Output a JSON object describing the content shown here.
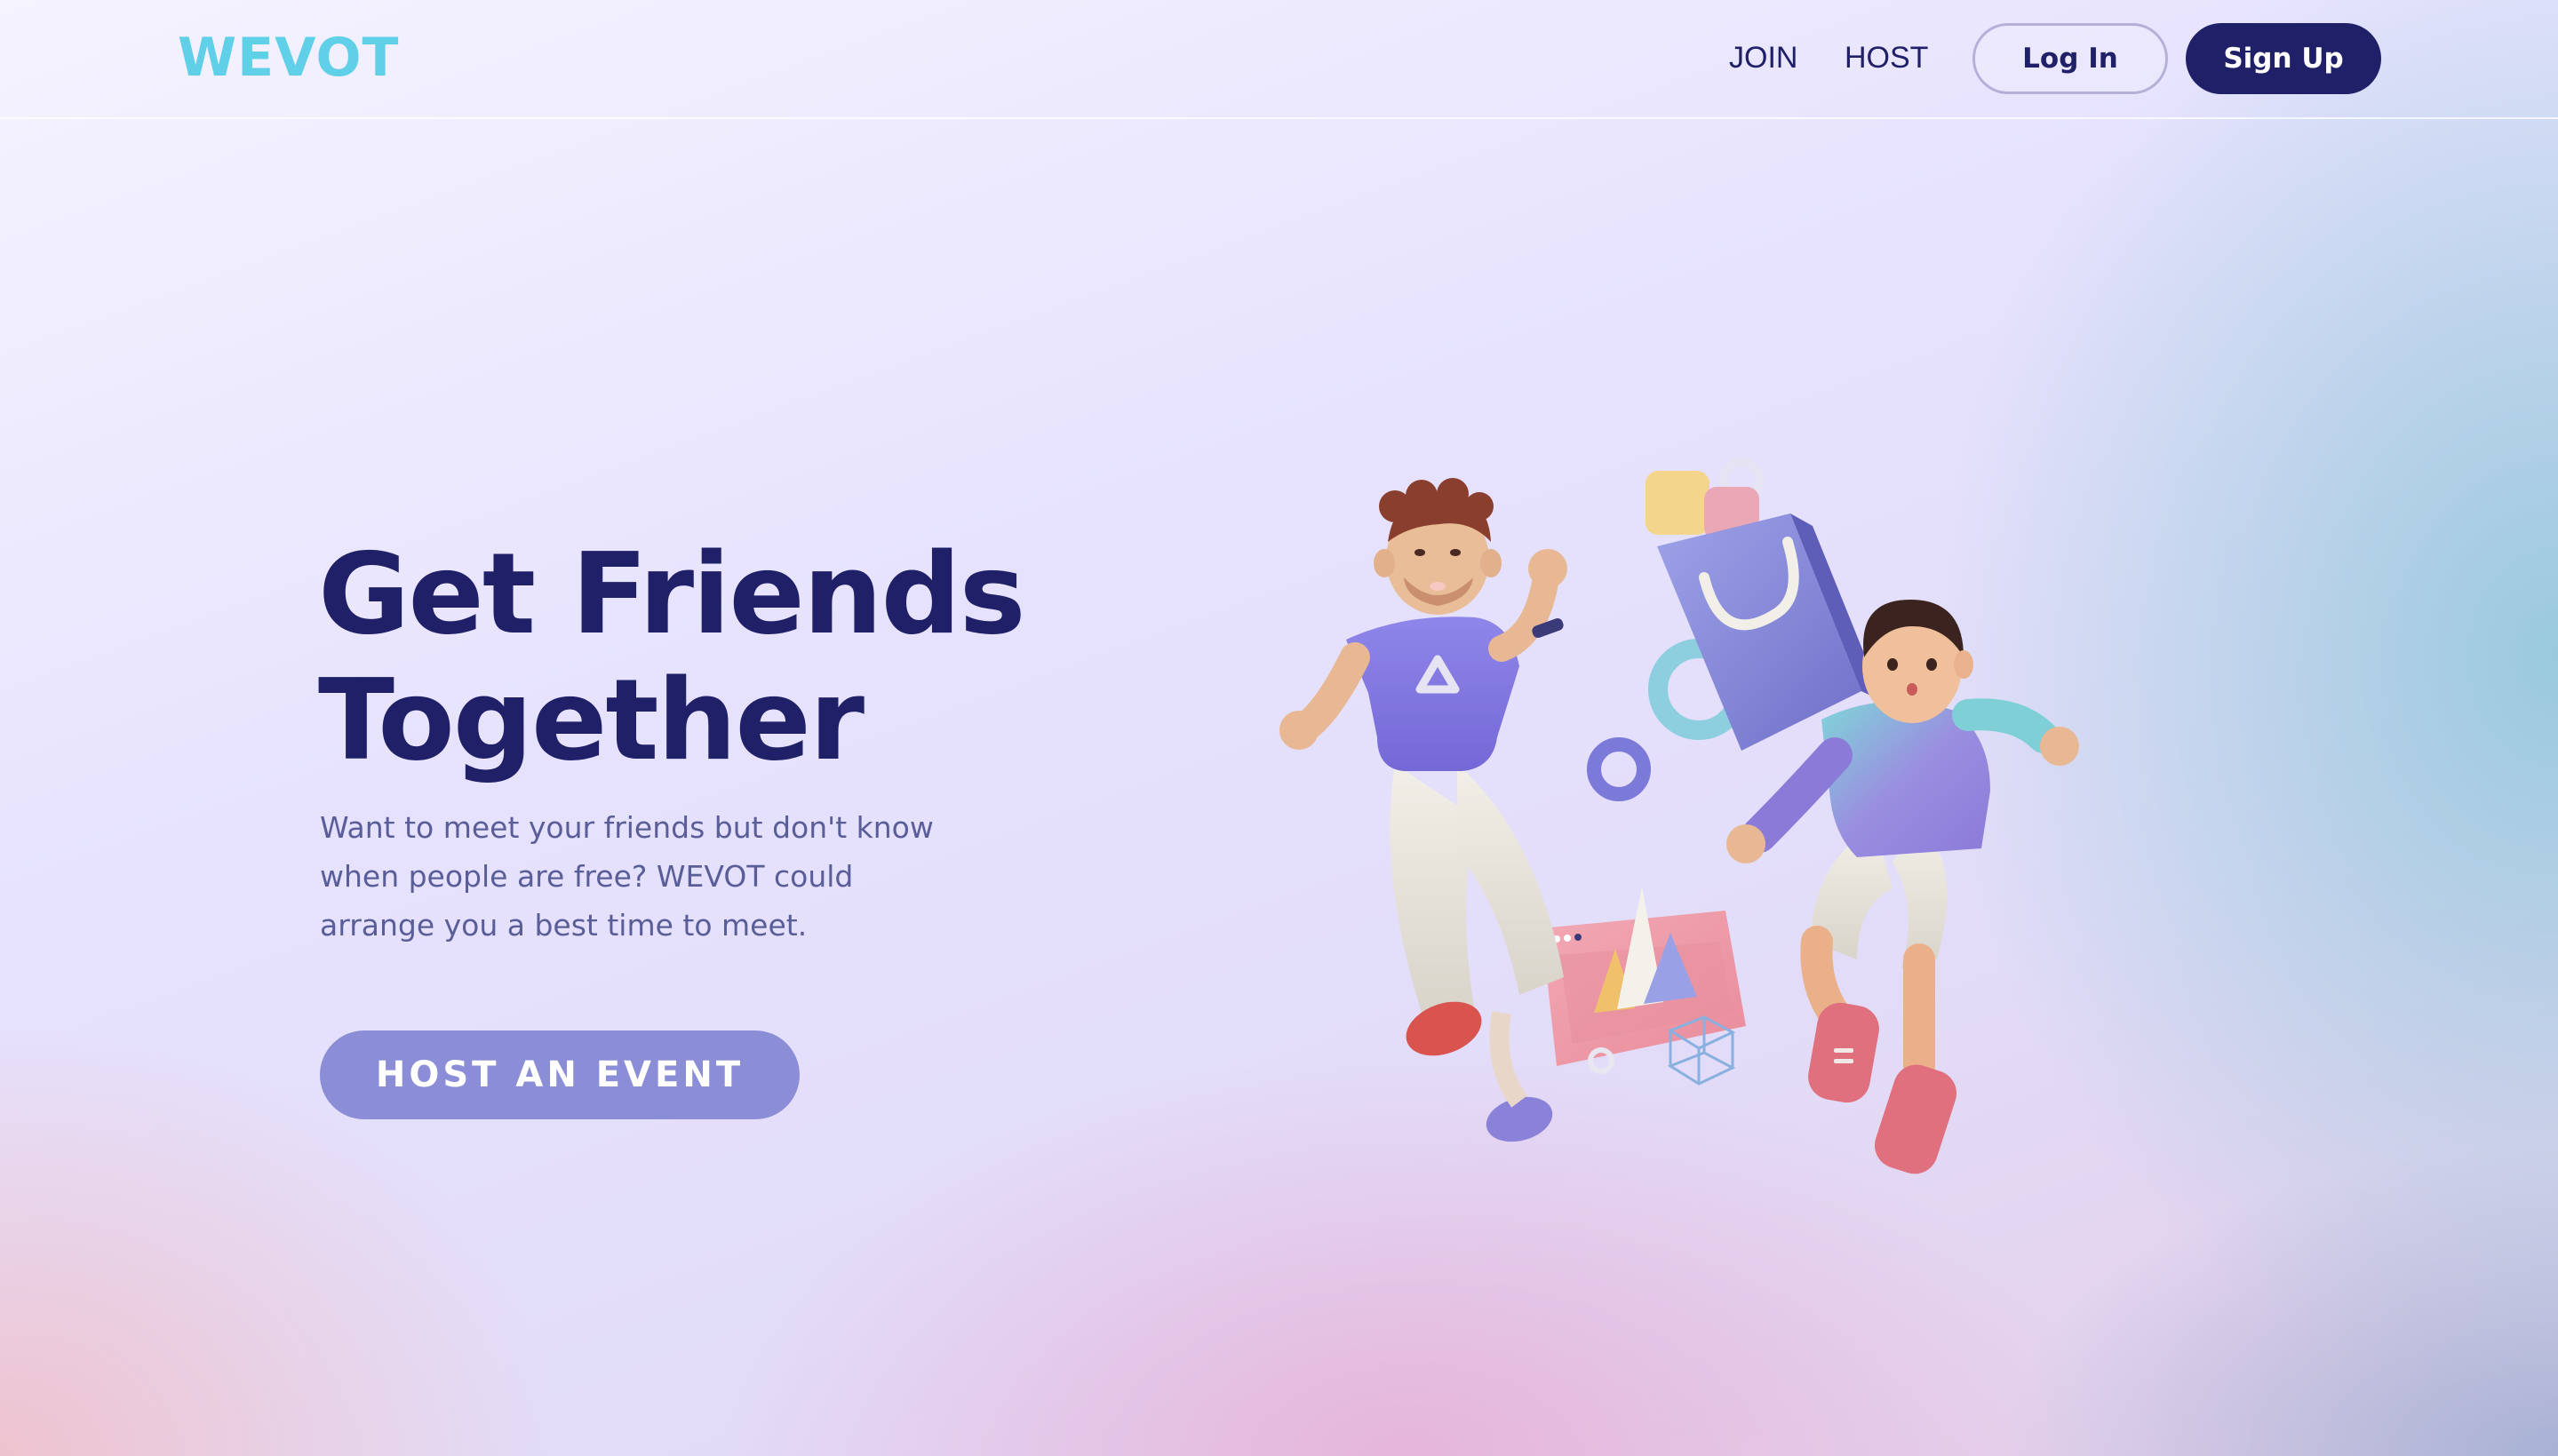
{
  "brand": {
    "logo": "WEVOT",
    "logo_color": "#5fd0e8"
  },
  "nav": {
    "links": [
      {
        "label": "JOIN"
      },
      {
        "label": "HOST"
      }
    ],
    "login_label": "Log In",
    "signup_label": "Sign Up"
  },
  "hero": {
    "title_line1": "Get Friends",
    "title_line2": "Together",
    "subtitle": "Want to meet your friends but don't know when people are free? WEVOT could arrange you a best time to meet.",
    "cta_label": "HOST AN EVENT"
  },
  "colors": {
    "navy": "#1f2068",
    "cta": "#8b8ed6",
    "subtitle": "#5a5e98"
  },
  "illustration": {
    "icon": "friends-3d-illustration"
  }
}
